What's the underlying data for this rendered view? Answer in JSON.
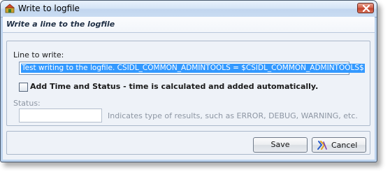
{
  "window": {
    "title": "Write to logfile",
    "app_icon": "app-icon",
    "close_icon": "close-icon"
  },
  "banner": {
    "text": "Write a line to the logfile"
  },
  "form": {
    "line_label": "Line to write:",
    "line_value": "Test writing to the logfile. CSIDL_COMMON_ADMINTOOLS = $CSIDL_COMMON_ADMINTOOLS$",
    "checkbox_label": "Add Time and Status - time is calculated and added automatically.",
    "checkbox_checked": false,
    "status_label": "Status:",
    "status_value": "",
    "status_hint": "Indicates type of results, such as ERROR, DEBUG, WARNING, etc."
  },
  "buttons": {
    "save_label": "Save",
    "cancel_label": "Cancel",
    "cancel_icon": "cancel-icon"
  },
  "colors": {
    "selection": "#3399ff",
    "close_button": "#c2412a",
    "disabled_text": "#8d96a3"
  }
}
